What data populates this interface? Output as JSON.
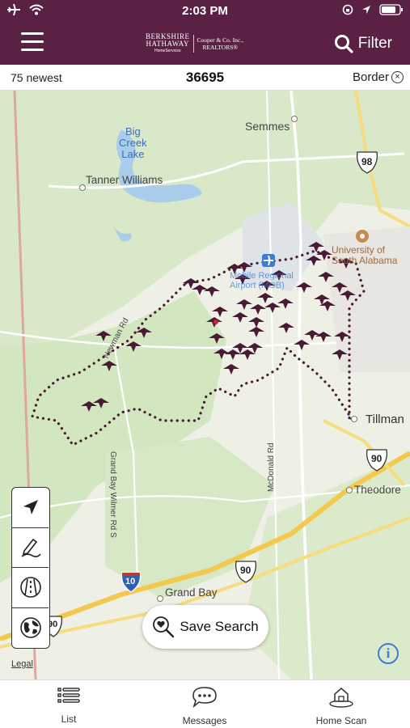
{
  "status": {
    "time": "2:03 PM"
  },
  "header": {
    "brand_line1": "BERKSHIRE",
    "brand_line2": "HATHAWAY",
    "brand_sub": "HomeServices",
    "brand_partner1": "Cooper & Co. Inc.,",
    "brand_partner2": "REALTORS®",
    "filter_label": "Filter"
  },
  "infobar": {
    "count_label": "75 newest",
    "zip": "36695",
    "border_label": "Border"
  },
  "map": {
    "labels": {
      "semmes": "Semmes",
      "big_creek_1": "Big",
      "big_creek_2": "Creek",
      "big_creek_3": "Lake",
      "tanner_williams": "Tanner Williams",
      "univ_1": "University of",
      "univ_2": "South Alabama",
      "airport": "Mobile Regional Airport (MOB)",
      "newman": "Newman Rd",
      "tillman": "Tillman",
      "theodore": "Theodore",
      "mcdonald": "McDonald Rd",
      "grand_bay_wilmer": "Grand Bay Wilmer Rd S",
      "grand_bay": "Grand Bay",
      "hwy_98": "98",
      "hwy_90a": "90",
      "hwy_90b": "90",
      "hwy_90c": "90",
      "i10": "10"
    }
  },
  "actions": {
    "save_search": "Save Search",
    "legal": "Legal",
    "info": "i"
  },
  "tabs": [
    {
      "label": "List",
      "icon": "list-icon"
    },
    {
      "label": "Messages",
      "icon": "messages-icon"
    },
    {
      "label": "Home Scan",
      "icon": "home-scan-icon"
    }
  ],
  "colors": {
    "brand": "#5b2144",
    "pin": "#4a1a34",
    "accent": "#3d7bd8",
    "road": "#f2c94c",
    "water": "#a9cdeb"
  }
}
